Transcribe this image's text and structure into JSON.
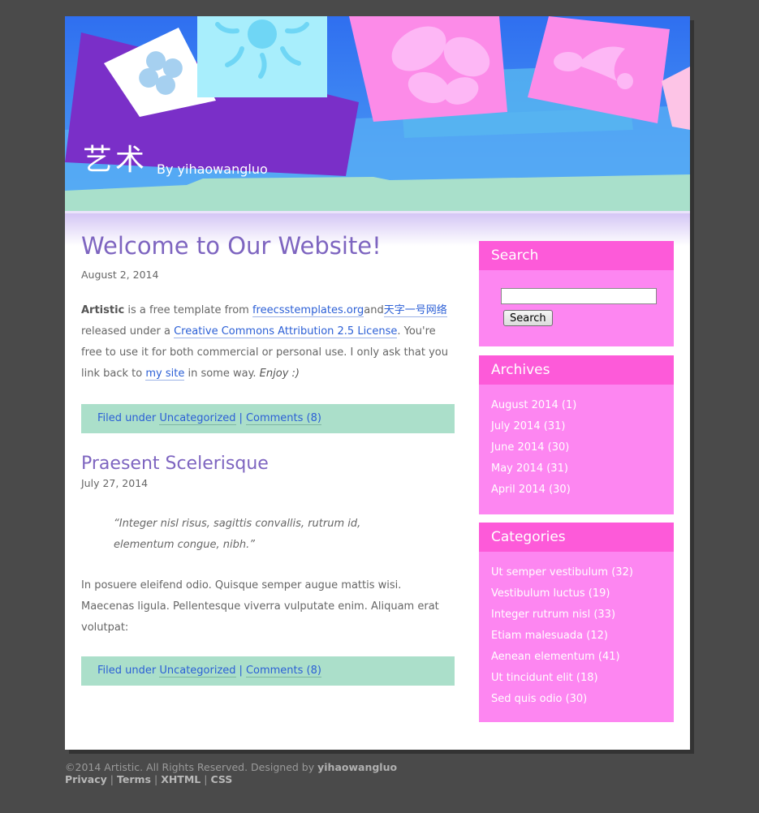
{
  "header": {
    "site_title": "艺术",
    "site_author": "By yihaowangluo"
  },
  "colors": {
    "page_bg": "#4a4a4a",
    "post_title": "#7e65c0",
    "link": "#2b5fd6",
    "filed_bar": "#abdfca",
    "widget_bg": "#fd86f1",
    "widget_title_bg": "#fd5ad9"
  },
  "posts": [
    {
      "title": "Welcome to Our Website!",
      "date": "August 2, 2014",
      "body": {
        "strong": "Artistic",
        "t1": " is a free template from ",
        "link1": "freecsstemplates.org",
        "t2": "and",
        "link2": "天字一号网络",
        "t3": " released under a ",
        "link3": "Creative Commons Attribution 2.5 License",
        "t4": ". You're free to use it for both commercial or personal use. I only ask that you link back to ",
        "link4": "my site",
        "t5": " in some way. ",
        "em": "Enjoy :)"
      },
      "filed_prefix": "Filed under ",
      "category": "Uncategorized",
      "separator": "|",
      "comments": "Comments (8)"
    },
    {
      "title": "Praesent Scelerisque",
      "date": "July 27, 2014",
      "quote": "“Integer nisl risus, sagittis convallis, rutrum id, elementum congue, nibh.”",
      "paragraph": "In posuere eleifend odio. Quisque semper augue mattis wisi. Maecenas ligula. Pellentesque viverra vulputate enim. Aliquam erat volutpat:",
      "filed_prefix": "Filed under ",
      "category": "Uncategorized",
      "separator": "|",
      "comments": "Comments (8)"
    }
  ],
  "sidebar": {
    "search": {
      "title": "Search",
      "input_value": "",
      "button_label": "Search"
    },
    "archives": {
      "title": "Archives",
      "items": [
        {
          "label": "August 2014",
          "count": "(1)"
        },
        {
          "label": "July 2014",
          "count": "(31)"
        },
        {
          "label": "June 2014",
          "count": "(30)"
        },
        {
          "label": "May 2014",
          "count": "(31)"
        },
        {
          "label": "April 2014",
          "count": "(30)"
        }
      ]
    },
    "categories": {
      "title": "Categories",
      "items": [
        {
          "label": "Ut semper vestibulum",
          "count": "(32)"
        },
        {
          "label": "Vestibulum luctus",
          "count": "(19)"
        },
        {
          "label": "Integer rutrum nisl",
          "count": "(33)"
        },
        {
          "label": "Etiam malesuada",
          "count": "(12)"
        },
        {
          "label": "Aenean elementum",
          "count": "(41)"
        },
        {
          "label": "Ut tincidunt elit",
          "count": "(18)"
        },
        {
          "label": "Sed quis odio",
          "count": "(30)"
        }
      ]
    }
  },
  "footer": {
    "copyright": "©2014 Artistic. All Rights Reserved. Designed by ",
    "designer": "yihaowangluo",
    "links": [
      "Privacy",
      "Terms",
      "XHTML",
      "CSS"
    ],
    "separator": "|"
  }
}
